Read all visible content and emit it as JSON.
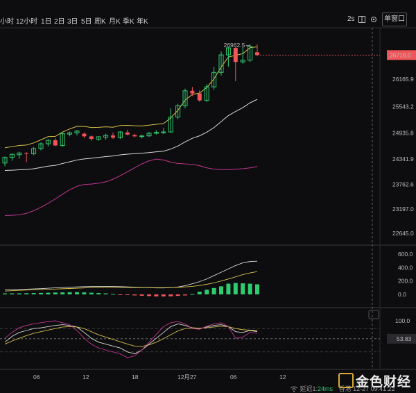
{
  "toolbar": {
    "timeframes": [
      "小时",
      "12小时",
      "1日",
      "2日",
      "3日",
      "5日",
      "周K",
      "月K",
      "季K",
      "年K"
    ],
    "interval": "2s",
    "window_mode": "单窗口"
  },
  "chart_data": [
    {
      "type": "candlestick",
      "panel": "price",
      "y_ticks": [
        26165.9,
        25543.2,
        24935.8,
        24341.9,
        23762.6,
        23197.0,
        22645.0
      ],
      "current_price_label": "26716.0",
      "high_annotation": "26962.5",
      "x_ticks": [
        "06",
        "12",
        "18",
        "12月27",
        "06",
        "12"
      ],
      "candles": [
        {
          "o": 24250,
          "h": 24400,
          "l": 24180,
          "c": 24380
        },
        {
          "o": 24380,
          "h": 24470,
          "l": 24300,
          "c": 24450
        },
        {
          "o": 24440,
          "h": 24510,
          "l": 24350,
          "c": 24480
        },
        {
          "o": 24470,
          "h": 24500,
          "l": 24270,
          "c": 24460
        },
        {
          "o": 24460,
          "h": 24620,
          "l": 24430,
          "c": 24580
        },
        {
          "o": 24580,
          "h": 24720,
          "l": 24540,
          "c": 24690
        },
        {
          "o": 24690,
          "h": 24790,
          "l": 24630,
          "c": 24770
        },
        {
          "o": 24770,
          "h": 24820,
          "l": 24640,
          "c": 24650
        },
        {
          "o": 24650,
          "h": 24950,
          "l": 24620,
          "c": 24920
        },
        {
          "o": 24910,
          "h": 24970,
          "l": 24860,
          "c": 24940
        },
        {
          "o": 24940,
          "h": 25000,
          "l": 24880,
          "c": 24980
        },
        {
          "o": 24920,
          "h": 24950,
          "l": 24820,
          "c": 24860
        },
        {
          "o": 24860,
          "h": 24880,
          "l": 24760,
          "c": 24800
        },
        {
          "o": 24790,
          "h": 24860,
          "l": 24760,
          "c": 24850
        },
        {
          "o": 24840,
          "h": 24920,
          "l": 24780,
          "c": 24880
        },
        {
          "o": 24880,
          "h": 24950,
          "l": 24800,
          "c": 24830
        },
        {
          "o": 24830,
          "h": 24980,
          "l": 24800,
          "c": 24960
        },
        {
          "o": 24950,
          "h": 25010,
          "l": 24880,
          "c": 24900
        },
        {
          "o": 24890,
          "h": 24920,
          "l": 24840,
          "c": 24860
        },
        {
          "o": 24860,
          "h": 24900,
          "l": 24810,
          "c": 24870
        },
        {
          "o": 24870,
          "h": 24960,
          "l": 24850,
          "c": 24930
        },
        {
          "o": 24930,
          "h": 25000,
          "l": 24900,
          "c": 24950
        },
        {
          "o": 24950,
          "h": 25050,
          "l": 24910,
          "c": 24960
        },
        {
          "o": 24960,
          "h": 25500,
          "l": 24940,
          "c": 25300
        },
        {
          "o": 25300,
          "h": 25600,
          "l": 25250,
          "c": 25560
        },
        {
          "o": 25560,
          "h": 25950,
          "l": 25500,
          "c": 25900
        },
        {
          "o": 25900,
          "h": 25990,
          "l": 25780,
          "c": 25840
        },
        {
          "o": 25840,
          "h": 25910,
          "l": 25650,
          "c": 25680
        },
        {
          "o": 25680,
          "h": 26050,
          "l": 25650,
          "c": 25990
        },
        {
          "o": 25990,
          "h": 26450,
          "l": 25920,
          "c": 26320
        },
        {
          "o": 26320,
          "h": 26800,
          "l": 26250,
          "c": 26720
        },
        {
          "o": 26720,
          "h": 26900,
          "l": 26450,
          "c": 26880
        },
        {
          "o": 26880,
          "h": 26900,
          "l": 26120,
          "c": 26560
        },
        {
          "o": 26560,
          "h": 26900,
          "l": 26520,
          "c": 26600
        },
        {
          "o": 26600,
          "h": 26962.5,
          "l": 26560,
          "c": 26920
        },
        {
          "o": 26780,
          "h": 26960,
          "l": 26690,
          "c": 26716
        }
      ]
    },
    {
      "type": "bar",
      "panel": "macd",
      "y_ticks": [
        600.0,
        400.0,
        200.0,
        0.0
      ]
    },
    {
      "type": "line",
      "panel": "kdj",
      "y_ticks": [
        100.0
      ],
      "crosshair_value": "53.83"
    }
  ],
  "status": {
    "delay_label": "延迟1:",
    "delay_value": "24ms",
    "time": "香港 12-27 09:41:22"
  },
  "colors": {
    "up": "#2ecc71",
    "down": "#f0555a",
    "ma_yellow": "#d8c24a",
    "ma_white": "#d9d9d9",
    "ma_pink": "#c2378f",
    "background": "#0d0d0f"
  },
  "watermark": "金色财经"
}
